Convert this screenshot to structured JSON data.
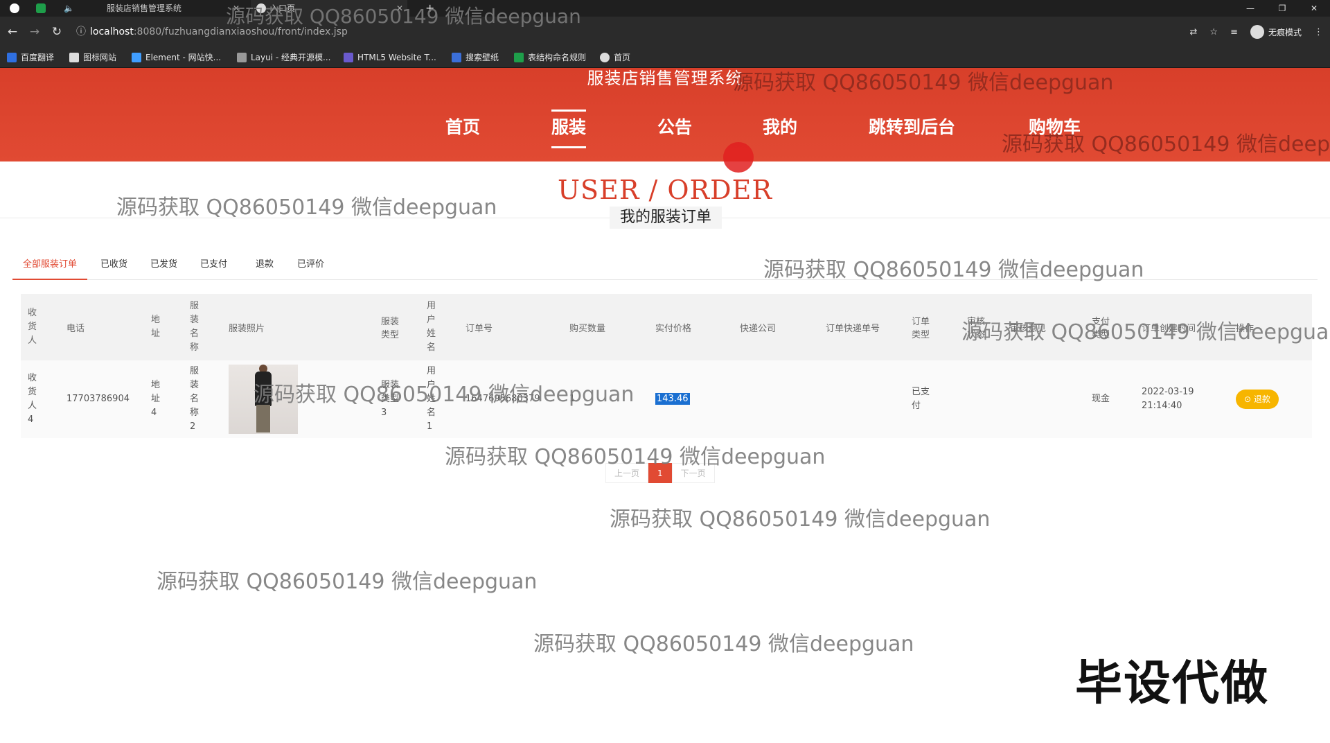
{
  "browser": {
    "tabs": [
      {
        "title": "服装店销售管理系统"
      },
      {
        "title": "入口页"
      }
    ],
    "url_host": "localhost",
    "url_path": ":8080/fuzhuangdianxiaoshou/front/index.jsp",
    "incognito_label": "无痕模式",
    "bookmarks": [
      "百度翻译",
      "图标网站",
      "Element - 网站快...",
      "Layui - 经典开源模...",
      "HTML5 Website T...",
      "搜索壁纸",
      "表结构命名规则",
      "首页"
    ]
  },
  "site": {
    "title": "服装店销售管理系统",
    "nav": [
      "首页",
      "服装",
      "公告",
      "我的",
      "跳转到后台",
      "购物车"
    ],
    "active_nav": "服装"
  },
  "section": {
    "title": "USER / ORDER",
    "subtitle": "我的服装订单"
  },
  "order_tabs": [
    "全部服装订单",
    "已收货",
    "已发货",
    "已支付",
    "退款",
    "已评价"
  ],
  "table": {
    "headers": [
      "收货人",
      "电话",
      "地址",
      "服装名称",
      "服装照片",
      "服装类型",
      "用户姓名",
      "订单号",
      "购买数量",
      "实付价格",
      "快递公司",
      "订单快递单号",
      "订单类型",
      "审核状态",
      "审核意见",
      "支付类型",
      "订单创建时间",
      "操作"
    ],
    "rows": [
      {
        "receiver": "收货人4",
        "phone": "17703786904",
        "address": "地址4",
        "clothing_name": "服装名称2",
        "clothing_type": "服装类型3",
        "user_name": "用户姓名1",
        "order_no": "1647695680379",
        "quantity": "1",
        "price": "143.46",
        "courier": "",
        "tracking_no": "",
        "order_type": "已支付",
        "review_status": "",
        "review_note": "",
        "pay_type": "现金",
        "created_date": "2022-03-19",
        "created_time": "21:14:40",
        "action": "退款"
      }
    ]
  },
  "pager": {
    "prev": "上一页",
    "current": "1",
    "next": "下一页"
  },
  "watermark": "源码获取 QQ86050149 微信deepguan",
  "corner_text": "毕设代做"
}
